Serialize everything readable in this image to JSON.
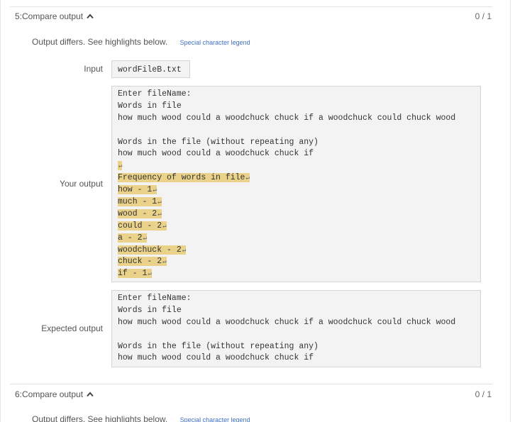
{
  "tests": [
    {
      "title": "5:Compare output",
      "score": "0 / 1",
      "status": "Output differs. See highlights below.",
      "legend_link": "Special character legend",
      "input_label": "Input",
      "input_value": "wordFileB.txt",
      "your_output_label": "Your output",
      "your_output_lines": [
        {
          "text": "Enter fileName:",
          "highlight": false,
          "newline_mark": false
        },
        {
          "text": "Words in file",
          "highlight": false,
          "newline_mark": false
        },
        {
          "text": "how much wood could a woodchuck chuck if a woodchuck could chuck wood",
          "highlight": false,
          "newline_mark": false
        },
        {
          "text": "",
          "highlight": false,
          "newline_mark": false
        },
        {
          "text": "Words in the file (without repeating any)",
          "highlight": false,
          "newline_mark": false
        },
        {
          "text": "how much wood could a woodchuck chuck if",
          "highlight": false,
          "newline_mark": false
        },
        {
          "text": "",
          "highlight": true,
          "newline_mark": true
        },
        {
          "text": "Frequency of words in file",
          "highlight": true,
          "newline_mark": true
        },
        {
          "text": "how - 1",
          "highlight": true,
          "newline_mark": true
        },
        {
          "text": "much - 1",
          "highlight": true,
          "newline_mark": true
        },
        {
          "text": "wood - 2",
          "highlight": true,
          "newline_mark": true
        },
        {
          "text": "could - 2",
          "highlight": true,
          "newline_mark": true
        },
        {
          "text": "a - 2",
          "highlight": true,
          "newline_mark": true
        },
        {
          "text": "woodchuck - 2",
          "highlight": true,
          "newline_mark": true
        },
        {
          "text": "chuck - 2",
          "highlight": true,
          "newline_mark": true
        },
        {
          "text": "if - 1",
          "highlight": true,
          "newline_mark": true
        }
      ],
      "expected_output_label": "Expected output",
      "expected_output_lines": [
        "Enter fileName:",
        "Words in file",
        "how much wood could a woodchuck chuck if a woodchuck could chuck wood",
        "",
        "Words in the file (without repeating any)",
        "how much wood could a woodchuck chuck if"
      ]
    },
    {
      "title": "6:Compare output",
      "score": "0 / 1",
      "status": "Output differs. See highlights below.",
      "legend_link": "Special character legend"
    }
  ],
  "newline_symbol": "↵",
  "colors": {
    "highlight": "#ead28a",
    "link": "#3f6fc4",
    "codebox_bg": "#f3f3f3"
  },
  "icons": {
    "collapse": "chevron-up-icon"
  }
}
